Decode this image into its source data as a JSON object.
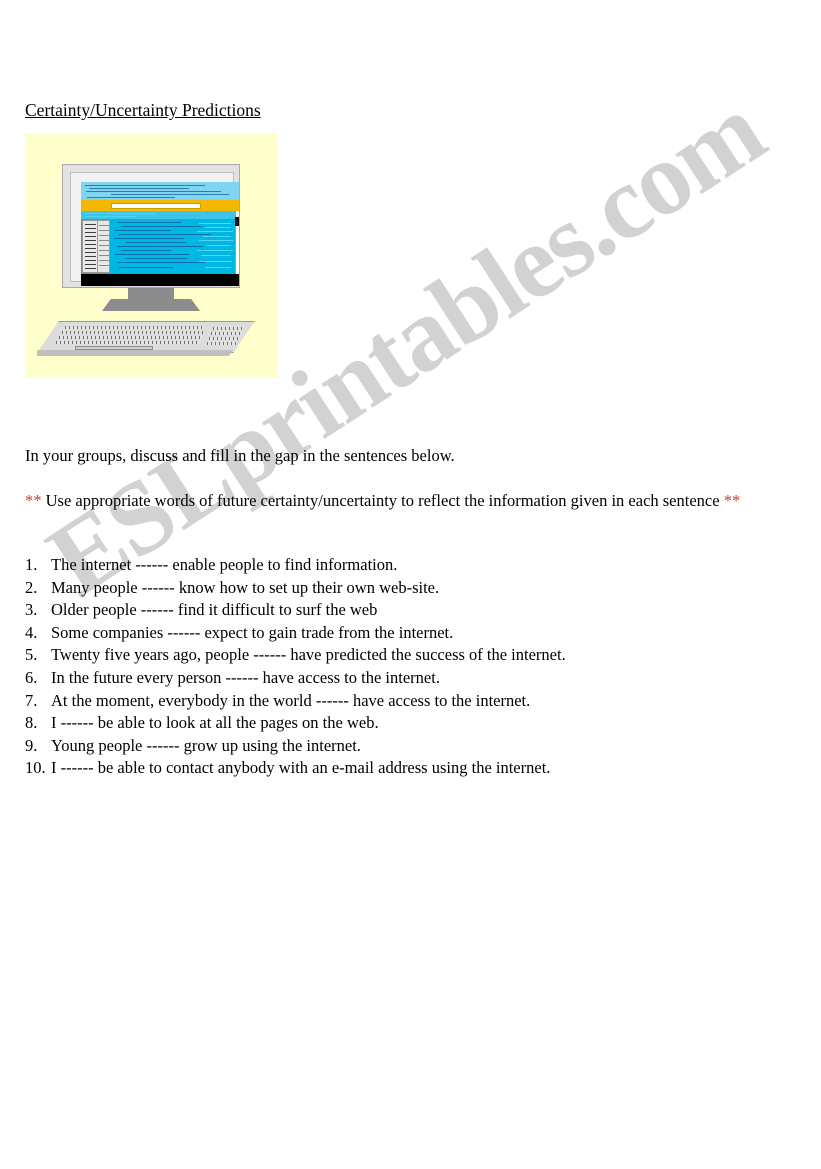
{
  "document": {
    "title": "Certainty/Uncertainty Predictions",
    "instruction": "In your groups, discuss and fill in the gap in the sentences below.",
    "note": {
      "prefix_stars": "**",
      "text": " Use appropriate words of future certainty/uncertainty to reflect the information given in each sentence ",
      "suffix_stars": "**"
    }
  },
  "watermark": {
    "text": "ESLprintables.com",
    "color": "#d2d2d2"
  },
  "clipart": {
    "name": "desktop-computer-clipart",
    "background_color": "#ffffcc",
    "screen": {
      "header_color": "#7fd4ef",
      "toolbar_color": "#f5b800",
      "content_color": "#00b7e4",
      "address_bar_color": "#ffffff",
      "taskbar_color": "#000000"
    },
    "case_color": "#e2e2e2",
    "stand_color": "#8c8c8c",
    "keyboard_color": "#dcdcdc"
  },
  "colors": {
    "text": "#000000",
    "accent_red": "#c04040",
    "page_background": "#ffffff"
  },
  "sentences": [
    {
      "num": "1.",
      "text": "The internet ------ enable people to find information."
    },
    {
      "num": "2.",
      "text": "Many people ------ know how to set up their own web-site."
    },
    {
      "num": "3.",
      "text": "Older people ------ find it difficult to surf the web"
    },
    {
      "num": "4.",
      "text": "Some companies ------ expect to gain trade from the internet."
    },
    {
      "num": "5.",
      "text": "Twenty five years ago, people ------ have predicted the success of the internet."
    },
    {
      "num": "6.",
      "text": "In the future every person ------ have access to the internet."
    },
    {
      "num": "7.",
      "text": "At the moment, everybody in the world ------ have access to the internet."
    },
    {
      "num": "8.",
      "text": "I ------ be able to look at all the pages on the web."
    },
    {
      "num": "9.",
      "text": "Young people ------ grow up using the internet."
    },
    {
      "num": "10.",
      "text": "I ------ be able to contact anybody with an e-mail address using the internet."
    }
  ]
}
